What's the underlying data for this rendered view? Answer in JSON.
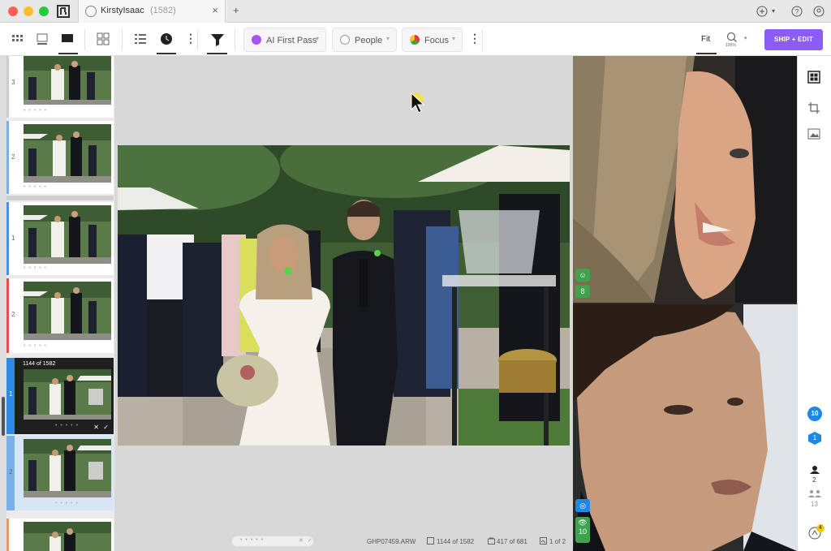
{
  "window": {
    "tab_title": "KirstyIsaac",
    "tab_count": "(1582)",
    "tab_close": "×",
    "new_tab": "+"
  },
  "colors": {
    "accent": "#8b5cf6",
    "mac_red": "#ff5f57",
    "mac_yellow": "#febc2e",
    "mac_green": "#28c840",
    "green_badge": "#3fa34d",
    "blue_badge": "#1e88e5",
    "select_blue": "#2d8ae6"
  },
  "toolbar": {
    "ai_first_pass": "AI First Pass",
    "people": "People",
    "focus": "Focus",
    "fit": "Fit",
    "zoom_level": "100%",
    "ship_edit": "SHIP + EDIT"
  },
  "thumbnails": [
    {
      "group": "3",
      "rating": "• • • • •"
    },
    {
      "group": "2",
      "rating": "• • • • •"
    },
    {
      "group": "1",
      "rating": "• • • • •"
    },
    {
      "group": "2",
      "rating": "• • • • •"
    },
    {
      "group": "1",
      "overlay": "1144 of 1582",
      "rating": "• • • • •",
      "selected": true
    },
    {
      "group": "2",
      "rating": "• • • • •"
    },
    {
      "group": "",
      "rating": ""
    }
  ],
  "status": {
    "rating": "• • • • •",
    "filename": "GHP07459.ARW",
    "position": "1144 of 1582",
    "filtered": "417 of 681",
    "pages": "1 of 2"
  },
  "faces": [
    {
      "badge_value": "8",
      "badge_icon": "smile-icon"
    },
    {
      "badge_value": "10",
      "badge_icon": "eye-icon"
    }
  ],
  "right_sidebar": {
    "badge_count": "10",
    "badge_hex": "1",
    "people_count": "2",
    "people_hidden_count": "13",
    "notifications": "4"
  }
}
